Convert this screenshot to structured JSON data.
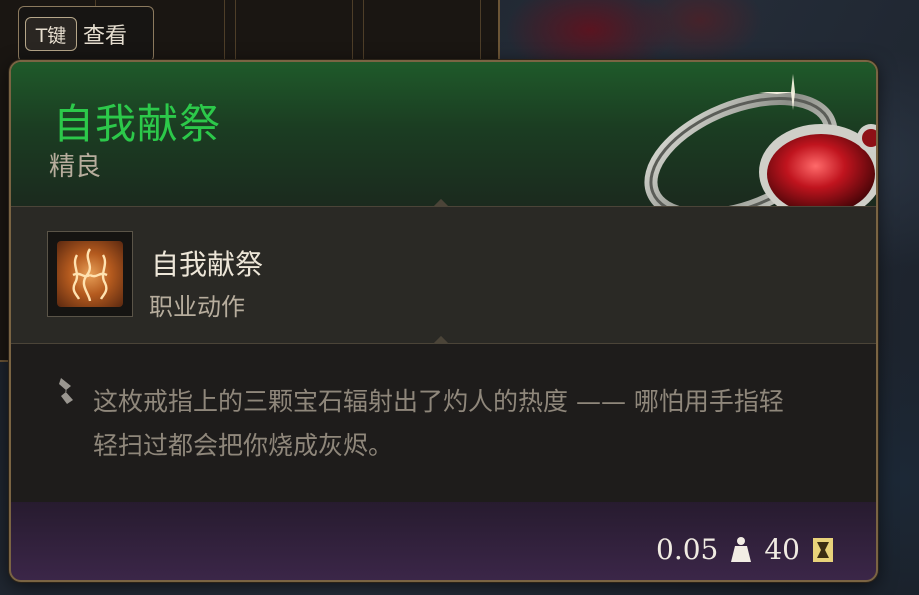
{
  "hint": {
    "key": "T键",
    "label": "查看"
  },
  "item": {
    "name": "自我献祭",
    "rarity": "精良",
    "rarity_color": "#2cc94a",
    "action": {
      "name": "自我献祭",
      "type": "职业动作"
    },
    "description": "这枚戒指上的三颗宝石辐射出了灼人的热度 —— 哪怕用手指轻轻扫过都会把你烧成灰烬。",
    "weight": "0.05",
    "value": "40"
  },
  "icons": {
    "ring": "ring-image",
    "action": "fire-spell-icon",
    "bullet": "bullet-icon",
    "weight": "weight-icon",
    "gold": "gold-icon"
  }
}
